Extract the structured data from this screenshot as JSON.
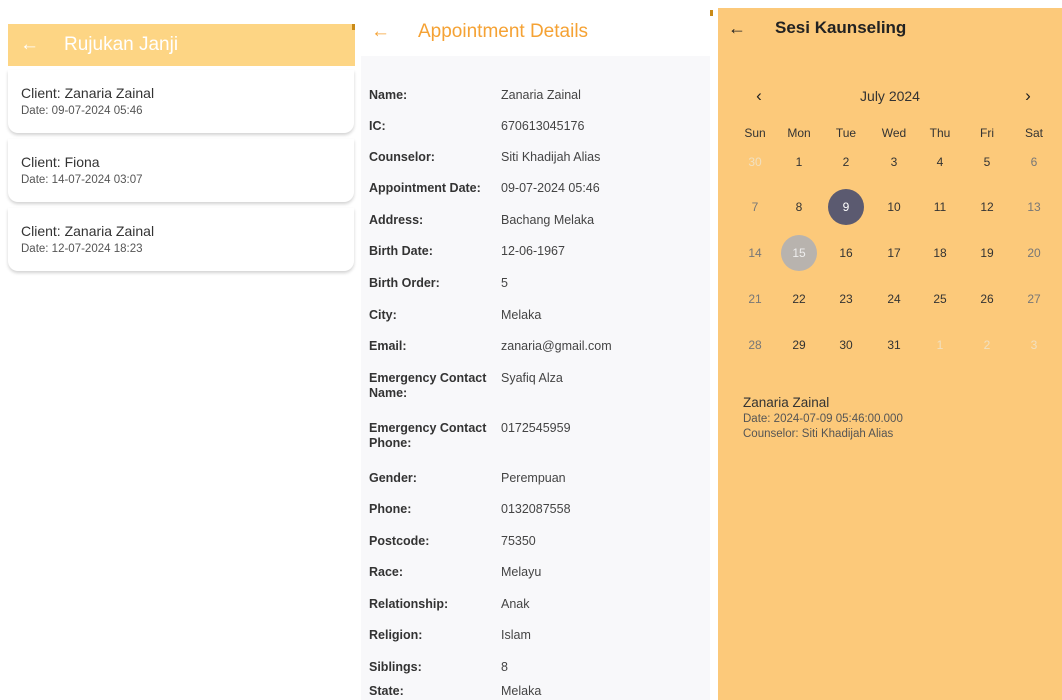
{
  "referrals": {
    "title": "Rujukan Janji",
    "back_icon": "←",
    "items": [
      {
        "client": "Client: Zanaria Zainal",
        "date": "Date: 09-07-2024 05:46"
      },
      {
        "client": "Client: Fiona",
        "date": "Date: 14-07-2024 03:07"
      },
      {
        "client": "Client: Zanaria Zainal",
        "date": "Date: 12-07-2024 18:23"
      }
    ]
  },
  "details": {
    "title": "Appointment Details",
    "back_icon": "←",
    "rows": [
      {
        "label": "Name:",
        "value": "Zanaria Zainal"
      },
      {
        "label": "IC:",
        "value": "670613045176"
      },
      {
        "label": "Counselor:",
        "value": "Siti Khadijah Alias"
      },
      {
        "label": "Appointment Date:",
        "value": "09-07-2024 05:46"
      },
      {
        "label": "Address:",
        "value": "Bachang Melaka"
      },
      {
        "label": "Birth Date:",
        "value": "12-06-1967"
      },
      {
        "label": "Birth Order:",
        "value": "5"
      },
      {
        "label": "City:",
        "value": "Melaka"
      },
      {
        "label": "Email:",
        "value": "zanaria@gmail.com"
      },
      {
        "label": "Emergency Contact Name:",
        "value": "Syafiq Alza"
      },
      {
        "label": "Emergency Contact Phone:",
        "value": "0172545959"
      },
      {
        "label": "Gender:",
        "value": "Perempuan"
      },
      {
        "label": "Phone:",
        "value": "0132087558"
      },
      {
        "label": "Postcode:",
        "value": "75350"
      },
      {
        "label": "Race:",
        "value": "Melayu"
      },
      {
        "label": "Relationship:",
        "value": "Anak"
      },
      {
        "label": "Religion:",
        "value": "Islam"
      },
      {
        "label": "Siblings:",
        "value": "8"
      },
      {
        "label": "State:",
        "value": "Melaka"
      }
    ]
  },
  "sessions": {
    "title": "Sesi Kaunseling",
    "back_icon": "←",
    "calendar": {
      "month": "July 2024",
      "prev_icon": "‹",
      "next_icon": "›",
      "weekdays": [
        "Sun",
        "Mon",
        "Tue",
        "Wed",
        "Thu",
        "Fri",
        "Sat"
      ],
      "weeks": [
        [
          "30",
          "1",
          "2",
          "3",
          "4",
          "5",
          "6"
        ],
        [
          "7",
          "8",
          "9",
          "10",
          "11",
          "12",
          "13"
        ],
        [
          "14",
          "15",
          "16",
          "17",
          "18",
          "19",
          "20"
        ],
        [
          "21",
          "22",
          "23",
          "24",
          "25",
          "26",
          "27"
        ],
        [
          "28",
          "29",
          "30",
          "31",
          "1",
          "2",
          "3"
        ]
      ],
      "selected_day": "9",
      "today_day": "15"
    },
    "event": {
      "name": "Zanaria Zainal",
      "date": "Date: 2024-07-09 05:46:00.000",
      "counselor": "Counselor: Siti Khadijah Alias"
    }
  },
  "colors": {
    "header_bg": "#fdd584",
    "accent_orange": "#f5a234",
    "calendar_bg": "#fcc97a",
    "selected_day": "#5b5a70",
    "today_day": "#b8b3ae"
  }
}
